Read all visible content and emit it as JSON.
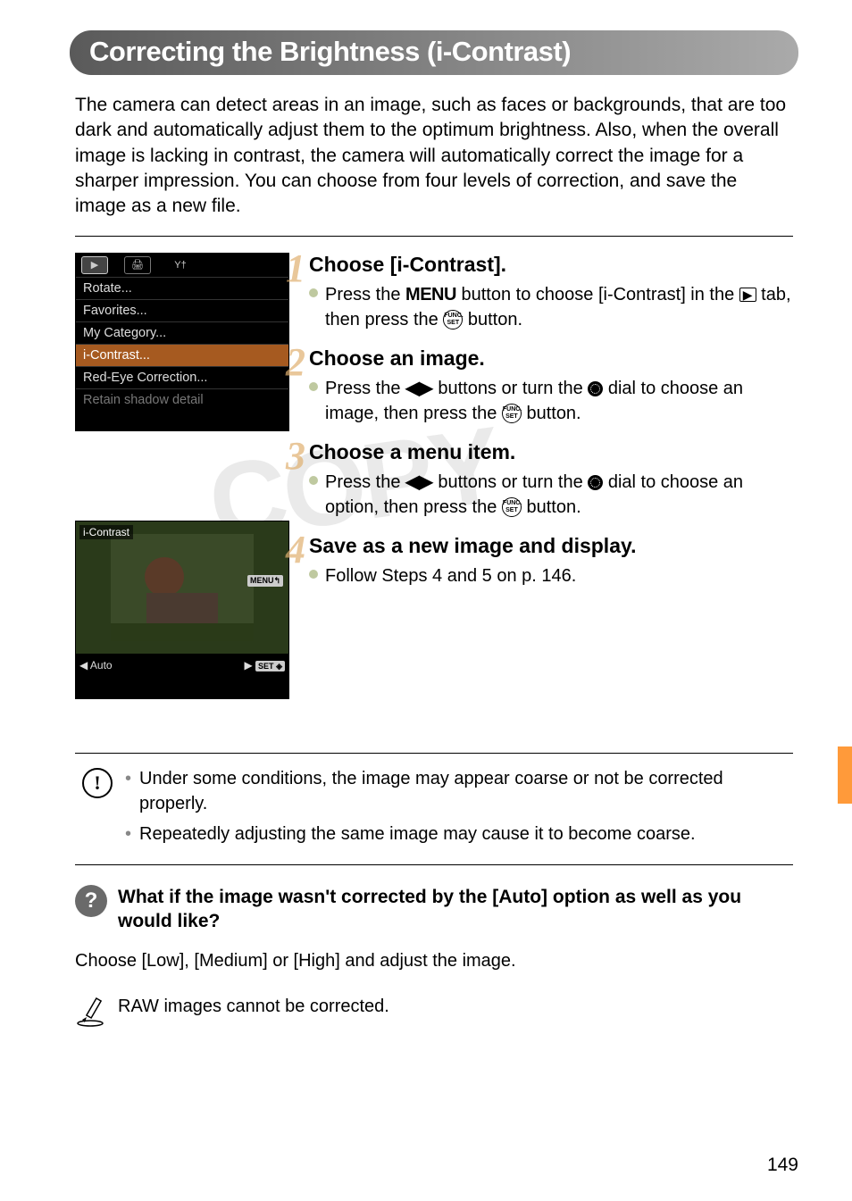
{
  "page_number": "149",
  "title": "Correcting the Brightness (i-Contrast)",
  "intro": "The camera can detect areas in an image, such as faces or backgrounds, that are too dark and automatically adjust them to the optimum brightness. Also, when the overall image is lacking in contrast, the camera will automatically correct the image for a sharper impression. You can choose from four levels of correction, and save the image as a new file.",
  "watermark": "COPY",
  "screenshot1": {
    "tab_icons": [
      "▶",
      "🖨",
      "Y†"
    ],
    "rows": [
      {
        "label": "Rotate...",
        "state": "normal"
      },
      {
        "label": "Favorites...",
        "state": "normal"
      },
      {
        "label": "My Category...",
        "state": "normal"
      },
      {
        "label": "i-Contrast...",
        "state": "selected"
      },
      {
        "label": "Red-Eye Correction...",
        "state": "normal"
      },
      {
        "label": "Retain shadow detail",
        "state": "dim"
      }
    ]
  },
  "screenshot2": {
    "tag": "i-Contrast",
    "left_label": "Auto",
    "menu_badge": "MENU",
    "set_badge": "SET",
    "back_icon": "↰",
    "ok_icon": "◈"
  },
  "steps": [
    {
      "num": "1",
      "heading": "Choose [i-Contrast].",
      "body_pre": "Press the ",
      "body_menu": "MENU",
      "body_mid": " button to choose [i-Contrast] in the ",
      "body_tab": "▶",
      "body_mid2": " tab, then press the ",
      "body_func": "FUNC. SET",
      "body_post": " button."
    },
    {
      "num": "2",
      "heading": "Choose an image.",
      "body_pre": "Press the ",
      "body_arrows": "◀▶",
      "body_mid": " buttons or turn the ",
      "body_mid2": " dial to choose an image, then press the ",
      "body_func": "FUNC. SET",
      "body_post": " button."
    },
    {
      "num": "3",
      "heading": "Choose a menu item.",
      "body_pre": "Press the ",
      "body_arrows": "◀▶",
      "body_mid": " buttons or turn the ",
      "body_mid2": " dial to choose an option, then press the ",
      "body_func": "FUNC. SET",
      "body_post": " button."
    },
    {
      "num": "4",
      "heading": "Save as a new image and display.",
      "body_full": "Follow Steps 4 and 5 on p. 146."
    }
  ],
  "warning": {
    "items": [
      "Under some conditions, the image may appear coarse or not be corrected properly.",
      "Repeatedly adjusting the same image may cause it to become coarse."
    ]
  },
  "tip": {
    "question": "What if the image wasn't corrected by the [Auto] option as well as you would like?",
    "answer": "Choose [Low], [Medium] or [High] and adjust the image."
  },
  "note": "RAW images cannot be corrected."
}
